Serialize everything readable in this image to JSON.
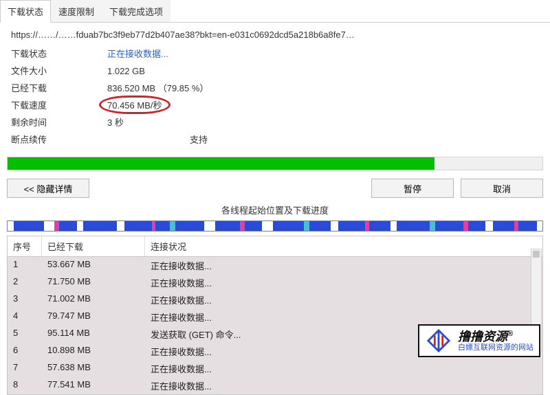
{
  "tabs": {
    "status": "下载状态",
    "speed_limit": "速度限制",
    "post_download": "下载完成选项"
  },
  "url": "https://……/……fduab7bc3f9eb77d2b407ae38?bkt=en-e031c0692dcd5a218b6a8fe7…",
  "labels": {
    "status": "下载状态",
    "size": "文件大小",
    "downloaded": "已经下载",
    "speed": "下载速度",
    "remaining": "剩余时间",
    "resume": "断点续传"
  },
  "values": {
    "status": "正在接收数据...",
    "size": "1.022  GB",
    "downloaded": "836.520  MB （79.85 %）",
    "speed": "70.456  MB/秒",
    "remaining": "3 秒",
    "resume": "支持"
  },
  "progress": {
    "percent": 79.85
  },
  "buttons": {
    "hide_details": "<<  隐藏详情",
    "pause": "暂停",
    "cancel": "取消"
  },
  "thread_section_title": "各线程起始位置及下载进度",
  "table": {
    "headers": {
      "idx": "序号",
      "downloaded": "已经下载",
      "conn": "连接状况"
    },
    "rows": [
      {
        "idx": "1",
        "downloaded": "53.667  MB",
        "conn": "正在接收数据..."
      },
      {
        "idx": "2",
        "downloaded": "71.750  MB",
        "conn": "正在接收数据..."
      },
      {
        "idx": "3",
        "downloaded": "71.002  MB",
        "conn": "正在接收数据..."
      },
      {
        "idx": "4",
        "downloaded": "79.747  MB",
        "conn": "正在接收数据..."
      },
      {
        "idx": "5",
        "downloaded": "95.114  MB",
        "conn": "发送获取 (GET) 命令..."
      },
      {
        "idx": "6",
        "downloaded": "10.898  MB",
        "conn": "正在接收数据..."
      },
      {
        "idx": "7",
        "downloaded": "57.638  MB",
        "conn": "正在接收数据..."
      },
      {
        "idx": "8",
        "downloaded": "77.541  MB",
        "conn": "正在接收数据..."
      }
    ]
  },
  "watermark": {
    "line1": "撸撸资源",
    "reg": "®",
    "line2": "白嫖互联网资源的网站"
  },
  "thread_segments": [
    {
      "w": 1.2,
      "c": "white"
    },
    {
      "w": 5.6,
      "c": "blue"
    },
    {
      "w": 2.0,
      "c": "white"
    },
    {
      "w": 0.8,
      "c": "mag"
    },
    {
      "w": 3.4,
      "c": "blue"
    },
    {
      "w": 1.2,
      "c": "white"
    },
    {
      "w": 6.2,
      "c": "blue"
    },
    {
      "w": 1.4,
      "c": "white"
    },
    {
      "w": 5.2,
      "c": "blue"
    },
    {
      "w": 0.6,
      "c": "mag"
    },
    {
      "w": 2.8,
      "c": "blue"
    },
    {
      "w": 1.0,
      "c": "cyan"
    },
    {
      "w": 5.4,
      "c": "blue"
    },
    {
      "w": 2.0,
      "c": "white"
    },
    {
      "w": 4.6,
      "c": "blue"
    },
    {
      "w": 1.0,
      "c": "mag"
    },
    {
      "w": 3.2,
      "c": "blue"
    },
    {
      "w": 2.0,
      "c": "white"
    },
    {
      "w": 5.8,
      "c": "blue"
    },
    {
      "w": 1.0,
      "c": "cyan"
    },
    {
      "w": 4.0,
      "c": "blue"
    },
    {
      "w": 1.4,
      "c": "white"
    },
    {
      "w": 5.0,
      "c": "blue"
    },
    {
      "w": 0.8,
      "c": "mag"
    },
    {
      "w": 4.0,
      "c": "blue"
    },
    {
      "w": 1.2,
      "c": "white"
    },
    {
      "w": 6.2,
      "c": "blue"
    },
    {
      "w": 1.0,
      "c": "cyan"
    },
    {
      "w": 5.2,
      "c": "blue"
    },
    {
      "w": 1.0,
      "c": "mag"
    },
    {
      "w": 3.2,
      "c": "blue"
    },
    {
      "w": 1.4,
      "c": "white"
    },
    {
      "w": 4.0,
      "c": "blue"
    },
    {
      "w": 0.8,
      "c": "mag"
    },
    {
      "w": 3.4,
      "c": "blue"
    }
  ]
}
